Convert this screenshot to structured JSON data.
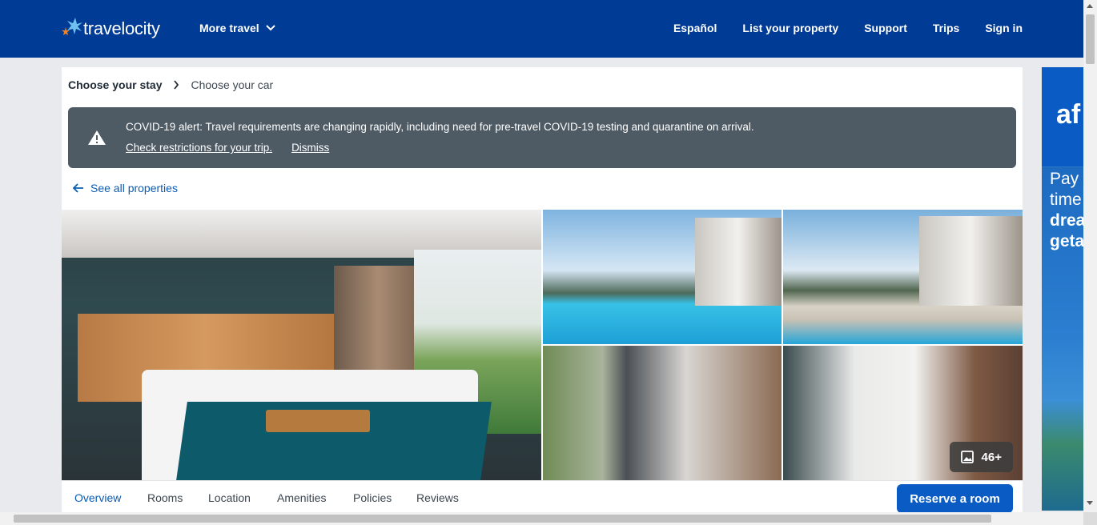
{
  "header": {
    "brand": "travelocity",
    "more_travel": "More travel",
    "nav": [
      "Español",
      "List your property",
      "Support",
      "Trips",
      "Sign in"
    ]
  },
  "breadcrumb": {
    "current": "Choose your stay",
    "next": "Choose your car"
  },
  "alert": {
    "message": "COVID-19 alert: Travel requirements are changing rapidly, including need for pre-travel COVID-19 testing and quarantine on arrival.",
    "link_restrictions": "Check restrictions for your trip.",
    "link_dismiss": "Dismiss"
  },
  "back_link": "See all properties",
  "gallery": {
    "photo_count": "46+"
  },
  "tabs": [
    "Overview",
    "Rooms",
    "Location",
    "Amenities",
    "Policies",
    "Reviews"
  ],
  "reserve_button": "Reserve a room",
  "ad": {
    "brand": "af",
    "lines": [
      "Pay o",
      "time",
      "drea",
      "geta"
    ]
  },
  "colors": {
    "header_bg": "#003b95",
    "alert_bg": "#4e5b65",
    "accent": "#0a5bc4"
  }
}
